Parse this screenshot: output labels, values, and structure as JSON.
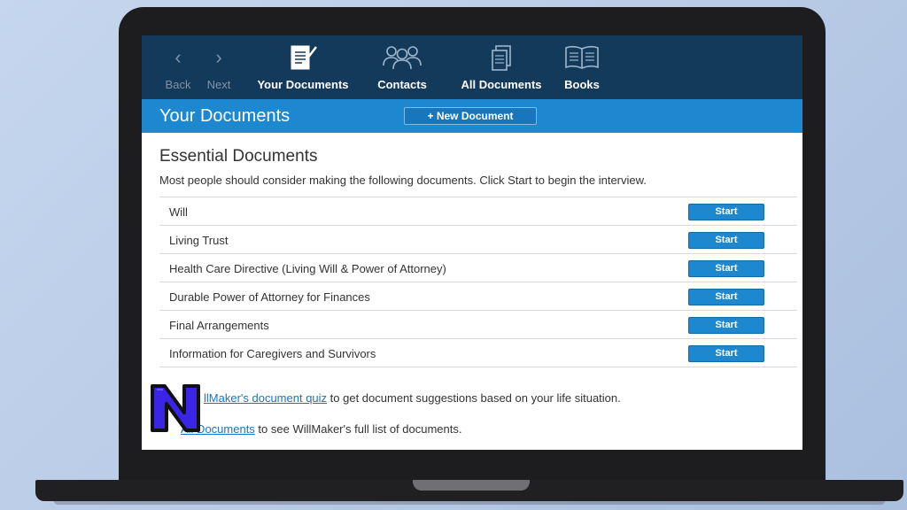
{
  "nav": {
    "back_label": "Back",
    "next_label": "Next",
    "your_documents_label": "Your Documents",
    "contacts_label": "Contacts",
    "all_documents_label": "All Documents",
    "books_label": "Books"
  },
  "titlebar": {
    "title": "Your Documents",
    "new_document_label": "+ New Document"
  },
  "essential": {
    "title": "Essential Documents",
    "description": "Most people should consider making the following documents. Click Start to begin the interview.",
    "start_label": "Start",
    "documents": [
      {
        "name": "Will"
      },
      {
        "name": "Living Trust"
      },
      {
        "name": "Health Care Directive (Living Will & Power of Attorney)"
      },
      {
        "name": "Durable Power of Attorney for Finances"
      },
      {
        "name": "Final Arrangements"
      },
      {
        "name": "Information for Caregivers and Survivors"
      }
    ]
  },
  "footer": {
    "quiz_link": "llMaker's document quiz",
    "quiz_text": " to get document suggestions based on your life situation.",
    "all_docs_link": "All Documents",
    "all_docs_text": " to see WillMaker's full list of documents."
  },
  "logo": {
    "letter": "N",
    "fill_color": "#3a24e6",
    "outline_color": "#111111"
  },
  "colors": {
    "nav_bg": "#143a5b",
    "title_bg": "#1d87cf",
    "button_bg": "#1d87cf",
    "link": "#1a73c7"
  }
}
